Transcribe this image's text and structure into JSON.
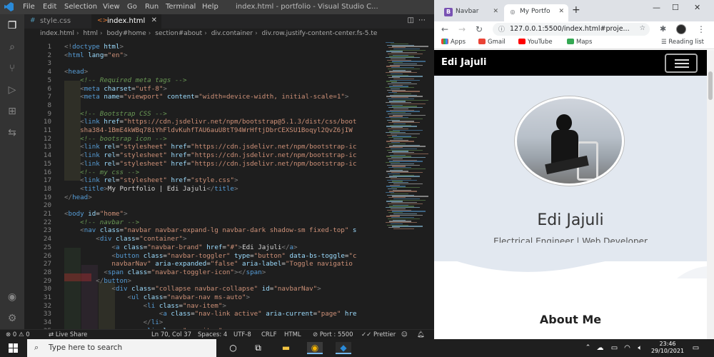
{
  "vscode": {
    "menu": [
      "File",
      "Edit",
      "Selection",
      "View",
      "Go",
      "Run",
      "Terminal",
      "Help"
    ],
    "window_title": "index.html - portfolio - Visual Studio C...",
    "tabs": [
      {
        "label": "style.css",
        "icon": "#"
      },
      {
        "label": "index.html",
        "icon": "<>"
      }
    ],
    "breadcrumb": [
      "index.html",
      "html",
      "body#home",
      "section#about",
      "div.container",
      "div.row.justify-content-center.fs-5.te"
    ],
    "lines": [
      {
        "n": "1",
        "html": "<span class='c-br'>&lt;!</span><span class='c-tag'>doctype</span> <span class='c-attr'>html</span><span class='c-br'>&gt;</span>"
      },
      {
        "n": "2",
        "html": "<span class='c-br'>&lt;</span><span class='c-tag'>html</span> <span class='c-attr'>lang</span>=<span class='c-str'>\"en\"</span><span class='c-br'>&gt;</span>"
      },
      {
        "n": "3",
        "html": ""
      },
      {
        "n": "4",
        "html": "<span class='c-br'>&lt;</span><span class='c-tag'>head</span><span class='c-br'>&gt;</span>"
      },
      {
        "n": "5",
        "html": "    <span class='c-com'>&lt;!-- Required meta tags --&gt;</span>"
      },
      {
        "n": "6",
        "html": "    <span class='c-br'>&lt;</span><span class='c-tag'>meta</span> <span class='c-attr'>charset</span>=<span class='c-str'>\"utf-8\"</span><span class='c-br'>&gt;</span>"
      },
      {
        "n": "7",
        "html": "    <span class='c-br'>&lt;</span><span class='c-tag'>meta</span> <span class='c-attr'>name</span>=<span class='c-str'>\"viewport\"</span> <span class='c-attr'>content</span>=<span class='c-str'>\"width=device-width, initial-scale=1\"</span><span class='c-br'>&gt;</span>"
      },
      {
        "n": "8",
        "html": ""
      },
      {
        "n": "9",
        "html": "    <span class='c-com'>&lt;!-- Bootstrap CSS --&gt;</span>"
      },
      {
        "n": "10",
        "html": "    <span class='c-br'>&lt;</span><span class='c-tag'>link</span> <span class='c-attr'>href</span>=<span class='c-str'>\"https://cdn.jsdelivr.net/npm/bootstrap@5.1.3/dist/css/boot</span>"
      },
      {
        "n": "11",
        "html": "    <span class='c-str'>sha384-1BmE4kWBq78iYhFldvKuhfTAU6auU8tT94WrHftjDbrCEXSU1Boqyl2QvZ6jIW</span>"
      },
      {
        "n": "12",
        "html": "    <span class='c-com'>&lt;!-- bootsrap icon --&gt;</span>"
      },
      {
        "n": "13",
        "html": "    <span class='c-br'>&lt;</span><span class='c-tag'>link</span> <span class='c-attr'>rel</span>=<span class='c-str'>\"stylesheet\"</span> <span class='c-attr'>href</span>=<span class='c-str'>\"https://cdn.jsdelivr.net/npm/bootstrap-ic</span>"
      },
      {
        "n": "14",
        "html": "    <span class='c-br'>&lt;</span><span class='c-tag'>link</span> <span class='c-attr'>rel</span>=<span class='c-str'>\"stylesheet\"</span> <span class='c-attr'>href</span>=<span class='c-str'>\"https://cdn.jsdelivr.net/npm/bootstrap-ic</span>"
      },
      {
        "n": "15",
        "html": "    <span class='c-br'>&lt;</span><span class='c-tag'>link</span> <span class='c-attr'>rel</span>=<span class='c-str'>\"stylesheet\"</span> <span class='c-attr'>href</span>=<span class='c-str'>\"https://cdn.jsdelivr.net/npm/bootstrap-ic</span>"
      },
      {
        "n": "16",
        "html": "    <span class='c-com'>&lt;!-- my css --&gt;</span>"
      },
      {
        "n": "17",
        "html": "    <span class='c-br'>&lt;</span><span class='c-tag'>link</span> <span class='c-attr'>rel</span>=<span class='c-str'>\"stylesheet\"</span> <span class='c-attr'>href</span>=<span class='c-str'>\"style.css\"</span><span class='c-br'>&gt;</span>"
      },
      {
        "n": "18",
        "html": "    <span class='c-br'>&lt;</span><span class='c-tag'>title</span><span class='c-br'>&gt;</span>My Portfolio | Edi Jajuli<span class='c-br'>&lt;/</span><span class='c-tag'>title</span><span class='c-br'>&gt;</span>"
      },
      {
        "n": "19",
        "html": "<span class='c-br'>&lt;/</span><span class='c-tag'>head</span><span class='c-br'>&gt;</span>"
      },
      {
        "n": "20",
        "html": ""
      },
      {
        "n": "21",
        "html": "<span class='c-br'>&lt;</span><span class='c-tag'>body</span> <span class='c-attr'>id</span>=<span class='c-str'>\"home\"</span><span class='c-br'>&gt;</span>"
      },
      {
        "n": "22",
        "html": "    <span class='c-com'>&lt;!-- navbar --&gt;</span>"
      },
      {
        "n": "23",
        "html": "    <span class='c-br'>&lt;</span><span class='c-tag'>nav</span> <span class='c-attr'>class</span>=<span class='c-str'>\"navbar navbar-expand-lg navbar-dark shadow-sm fixed-top\"</span> <span class='c-attr'>s</span>"
      },
      {
        "n": "24",
        "html": "        <span class='c-br'>&lt;</span><span class='c-tag'>div</span> <span class='c-attr'>class</span>=<span class='c-str'>\"container\"</span><span class='c-br'>&gt;</span>"
      },
      {
        "n": "25",
        "html": "            <span class='c-br'>&lt;</span><span class='c-tag'>a</span> <span class='c-attr'>class</span>=<span class='c-str'>\"navbar-brand\"</span> <span class='c-attr'>href</span>=<span class='c-str'>\"#\"</span><span class='c-br'>&gt;</span>Edi Jajuli<span class='c-br'>&lt;/</span><span class='c-tag'>a</span><span class='c-br'>&gt;</span>"
      },
      {
        "n": "26",
        "html": "            <span class='c-br'>&lt;</span><span class='c-tag'>button</span> <span class='c-attr'>class</span>=<span class='c-str'>\"navbar-toggler\"</span> <span class='c-attr'>type</span>=<span class='c-str'>\"button\"</span> <span class='c-attr'>data-bs-toggle</span>=<span class='c-str'>\"c</span>"
      },
      {
        "n": "27",
        "html": "            <span class='c-str'>navbarNav\"</span> <span class='c-attr'>aria-expanded</span>=<span class='c-str'>\"false\"</span> <span class='c-attr'>aria-label</span>=<span class='c-str'>\"Toggle navigatio</span>"
      },
      {
        "n": "28",
        "html": "          <span class='c-br'>&lt;</span><span class='c-tag'>span</span> <span class='c-attr'>class</span>=<span class='c-str'>\"navbar-toggler-icon\"</span><span class='c-br'>&gt;&lt;/</span><span class='c-tag'>span</span><span class='c-br'>&gt;</span>"
      },
      {
        "n": "29",
        "html": "        <span class='c-br'>&lt;/</span><span class='c-tag'>button</span><span class='c-br'>&gt;</span>"
      },
      {
        "n": "30",
        "html": "            <span class='c-br'>&lt;</span><span class='c-tag'>div</span> <span class='c-attr'>class</span>=<span class='c-str'>\"collapse navbar-collapse\"</span> <span class='c-attr'>id</span>=<span class='c-str'>\"navbarNav\"</span><span class='c-br'>&gt;</span>"
      },
      {
        "n": "31",
        "html": "                <span class='c-br'>&lt;</span><span class='c-tag'>ul</span> <span class='c-attr'>class</span>=<span class='c-str'>\"navbar-nav ms-auto\"</span><span class='c-br'>&gt;</span>"
      },
      {
        "n": "32",
        "html": "                    <span class='c-br'>&lt;</span><span class='c-tag'>li</span> <span class='c-attr'>class</span>=<span class='c-str'>\"nav-item\"</span><span class='c-br'>&gt;</span>"
      },
      {
        "n": "33",
        "html": "                        <span class='c-br'>&lt;</span><span class='c-tag'>a</span> <span class='c-attr'>class</span>=<span class='c-str'>\"nav-link active\"</span> <span class='c-attr'>aria-current</span>=<span class='c-str'>\"page\"</span> <span class='c-attr'>hre</span>"
      },
      {
        "n": "34",
        "html": "                    <span class='c-br'>&lt;/</span><span class='c-tag'>li</span><span class='c-br'>&gt;</span>"
      },
      {
        "n": "35",
        "html": "                    <span class='c-br'>&lt;</span><span class='c-tag'>li</span> <span class='c-attr'>class</span>=<span class='c-str'>\"nav-item\"</span><span class='c-br'>&gt;</span>"
      }
    ],
    "status": {
      "errors": "0",
      "warnings": "0",
      "live_share": "Live Share",
      "position": "Ln 70, Col 37",
      "spaces": "Spaces: 4",
      "encoding": "UTF-8",
      "eol": "CRLF",
      "language": "HTML",
      "port": "Port : 5500",
      "prettier": "Prettier"
    }
  },
  "chrome": {
    "tabs": [
      {
        "label": "Navbar",
        "favicon": "B",
        "favicon_color": "#7952b3"
      },
      {
        "label": "My Portfo",
        "favicon": "◎",
        "favicon_color": "#5f6368"
      }
    ],
    "url": "127.0.0.1:5500/index.html#proje...",
    "bookmarks": [
      "Apps",
      "Gmail",
      "YouTube",
      "Maps"
    ],
    "reading_list": "Reading list",
    "page": {
      "brand": "Edi Jajuli",
      "name": "Edi Jajuli",
      "subtitle": "Electrical Engineer | Web Developer",
      "about_heading": "About Me"
    }
  },
  "taskbar": {
    "search_placeholder": "Type here to search",
    "time": "23:46",
    "date": "29/10/2021"
  },
  "colors": {
    "vscode_bg": "#1e1e1e",
    "accent_blue": "#2a8ad8",
    "hero_bg": "#e2e8f0"
  }
}
